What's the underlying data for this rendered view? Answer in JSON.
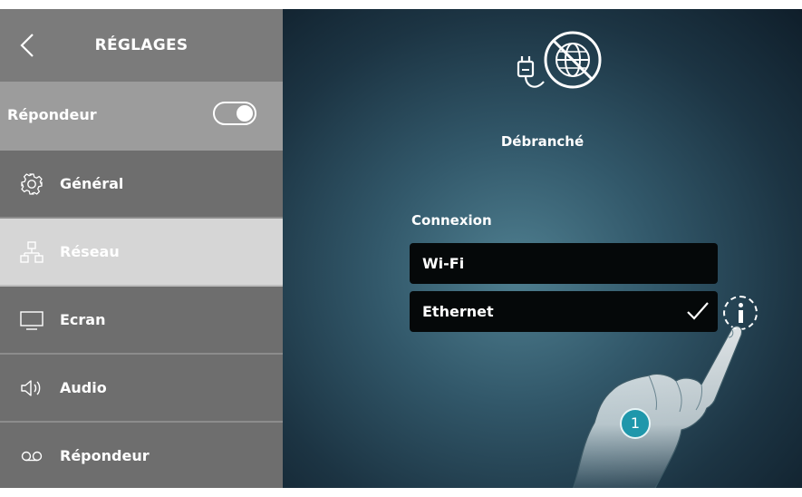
{
  "sidebar": {
    "title": "RÉGLAGES",
    "top_row": {
      "label": "Répondeur",
      "toggle_on": true
    },
    "items": [
      {
        "label": "Général",
        "icon": "gear-icon",
        "active": false
      },
      {
        "label": "Réseau",
        "icon": "network-icon",
        "active": true
      },
      {
        "label": "Ecran",
        "icon": "monitor-icon",
        "active": false
      },
      {
        "label": "Audio",
        "icon": "speaker-icon",
        "active": false
      },
      {
        "label": "Répondeur",
        "icon": "voicemail-icon",
        "active": false
      }
    ]
  },
  "main": {
    "status_icon": "ethernet-disconnected-icon",
    "status_text": "Débranché",
    "connection_label": "Connexion",
    "options": [
      {
        "label": "Wi-Fi",
        "selected": false
      },
      {
        "label": "Ethernet",
        "selected": true
      }
    ],
    "info_icon": "info-icon",
    "step_badge": "1"
  },
  "colors": {
    "sidebar_bg": "#6e6e6e",
    "sidebar_active_bg": "#d6d6d6",
    "option_bg": "#050809",
    "badge": "#1f97ab"
  }
}
